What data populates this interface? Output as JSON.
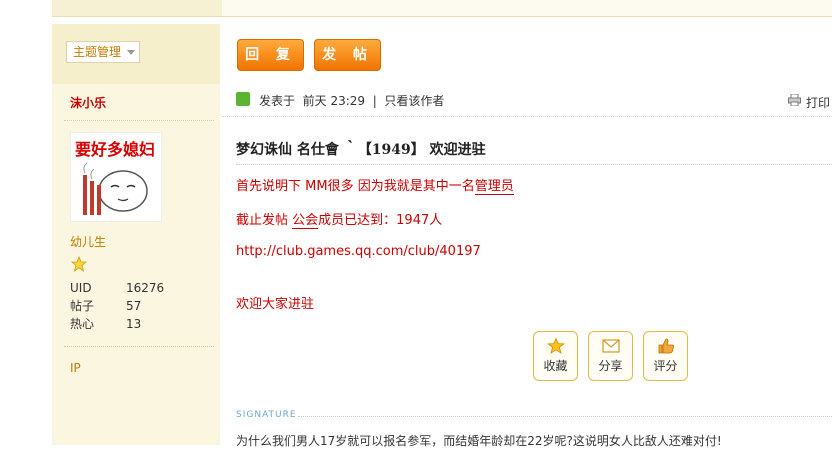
{
  "toolbar": {
    "reply_label": "回 复",
    "post_label": "发 帖"
  },
  "sidebar": {
    "manage_label": "主题管理",
    "username": "沫小乐",
    "rank": "幼儿生",
    "stats": [
      {
        "key": "UID",
        "value": "16276"
      },
      {
        "key": "帖子",
        "value": "57"
      },
      {
        "key": "热心",
        "value": "13"
      }
    ],
    "ip_label": "IP"
  },
  "post": {
    "posted_label": "发表于",
    "time": "前天 23:29",
    "divider": "|",
    "only_author": "只看该作者",
    "print_label": "打印",
    "title": "梦幻诛仙 名仕會 ｀【1949】 欢迎进驻",
    "line1_prefix": "首先说明下    MM很多    因为我就是其中一名",
    "line1_link": "管理员",
    "line2_prefix": "截止发帖    ",
    "line2_link": "公会",
    "line2_suffix": "成员已达到：1947人",
    "url": "http://club.games.qq.com/club/40197",
    "welcome": "欢迎大家进驻"
  },
  "actions": [
    {
      "label": "收藏",
      "icon": "star-icon"
    },
    {
      "label": "分享",
      "icon": "envelope-icon"
    },
    {
      "label": "评分",
      "icon": "thumbs-up-icon"
    }
  ],
  "signature": {
    "heading": "SIGNATURE",
    "text": "为什么我们男人17岁就可以报名参军，而结婚年龄却在22岁呢?这说明女人比敌人还难对付!"
  },
  "colors": {
    "accent": "#f07400",
    "name": "#cc0000",
    "rank": "#c47a00"
  }
}
